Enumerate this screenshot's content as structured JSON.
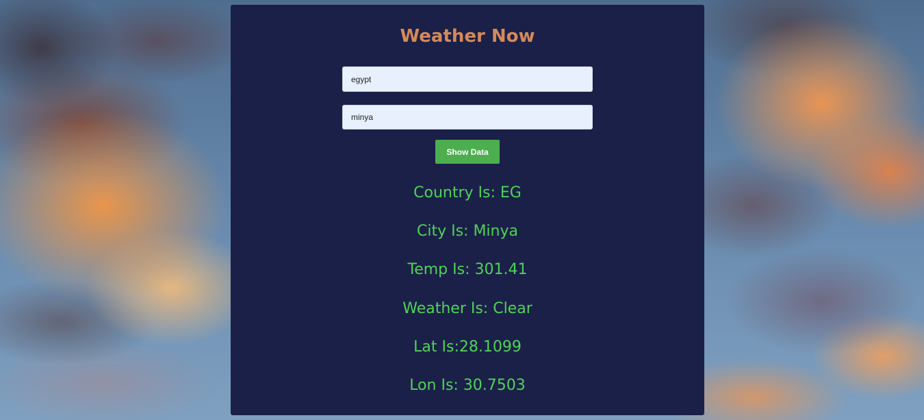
{
  "app": {
    "title": "Weather Now"
  },
  "form": {
    "country_value": "egypt",
    "city_value": "minya",
    "submit_label": "Show Data"
  },
  "results": {
    "country": "Country Is: EG",
    "city": "City Is: Minya",
    "temp": "Temp Is: 301.41",
    "weather": "Weather Is: Clear",
    "lat": "Lat Is:28.1099",
    "lon": "Lon Is: 30.7503"
  },
  "colors": {
    "panel_background": "#1b2049",
    "title": "#d48a58",
    "result_text": "#4fd355",
    "button": "#4cae4f",
    "input_background": "#e8f0fe"
  }
}
